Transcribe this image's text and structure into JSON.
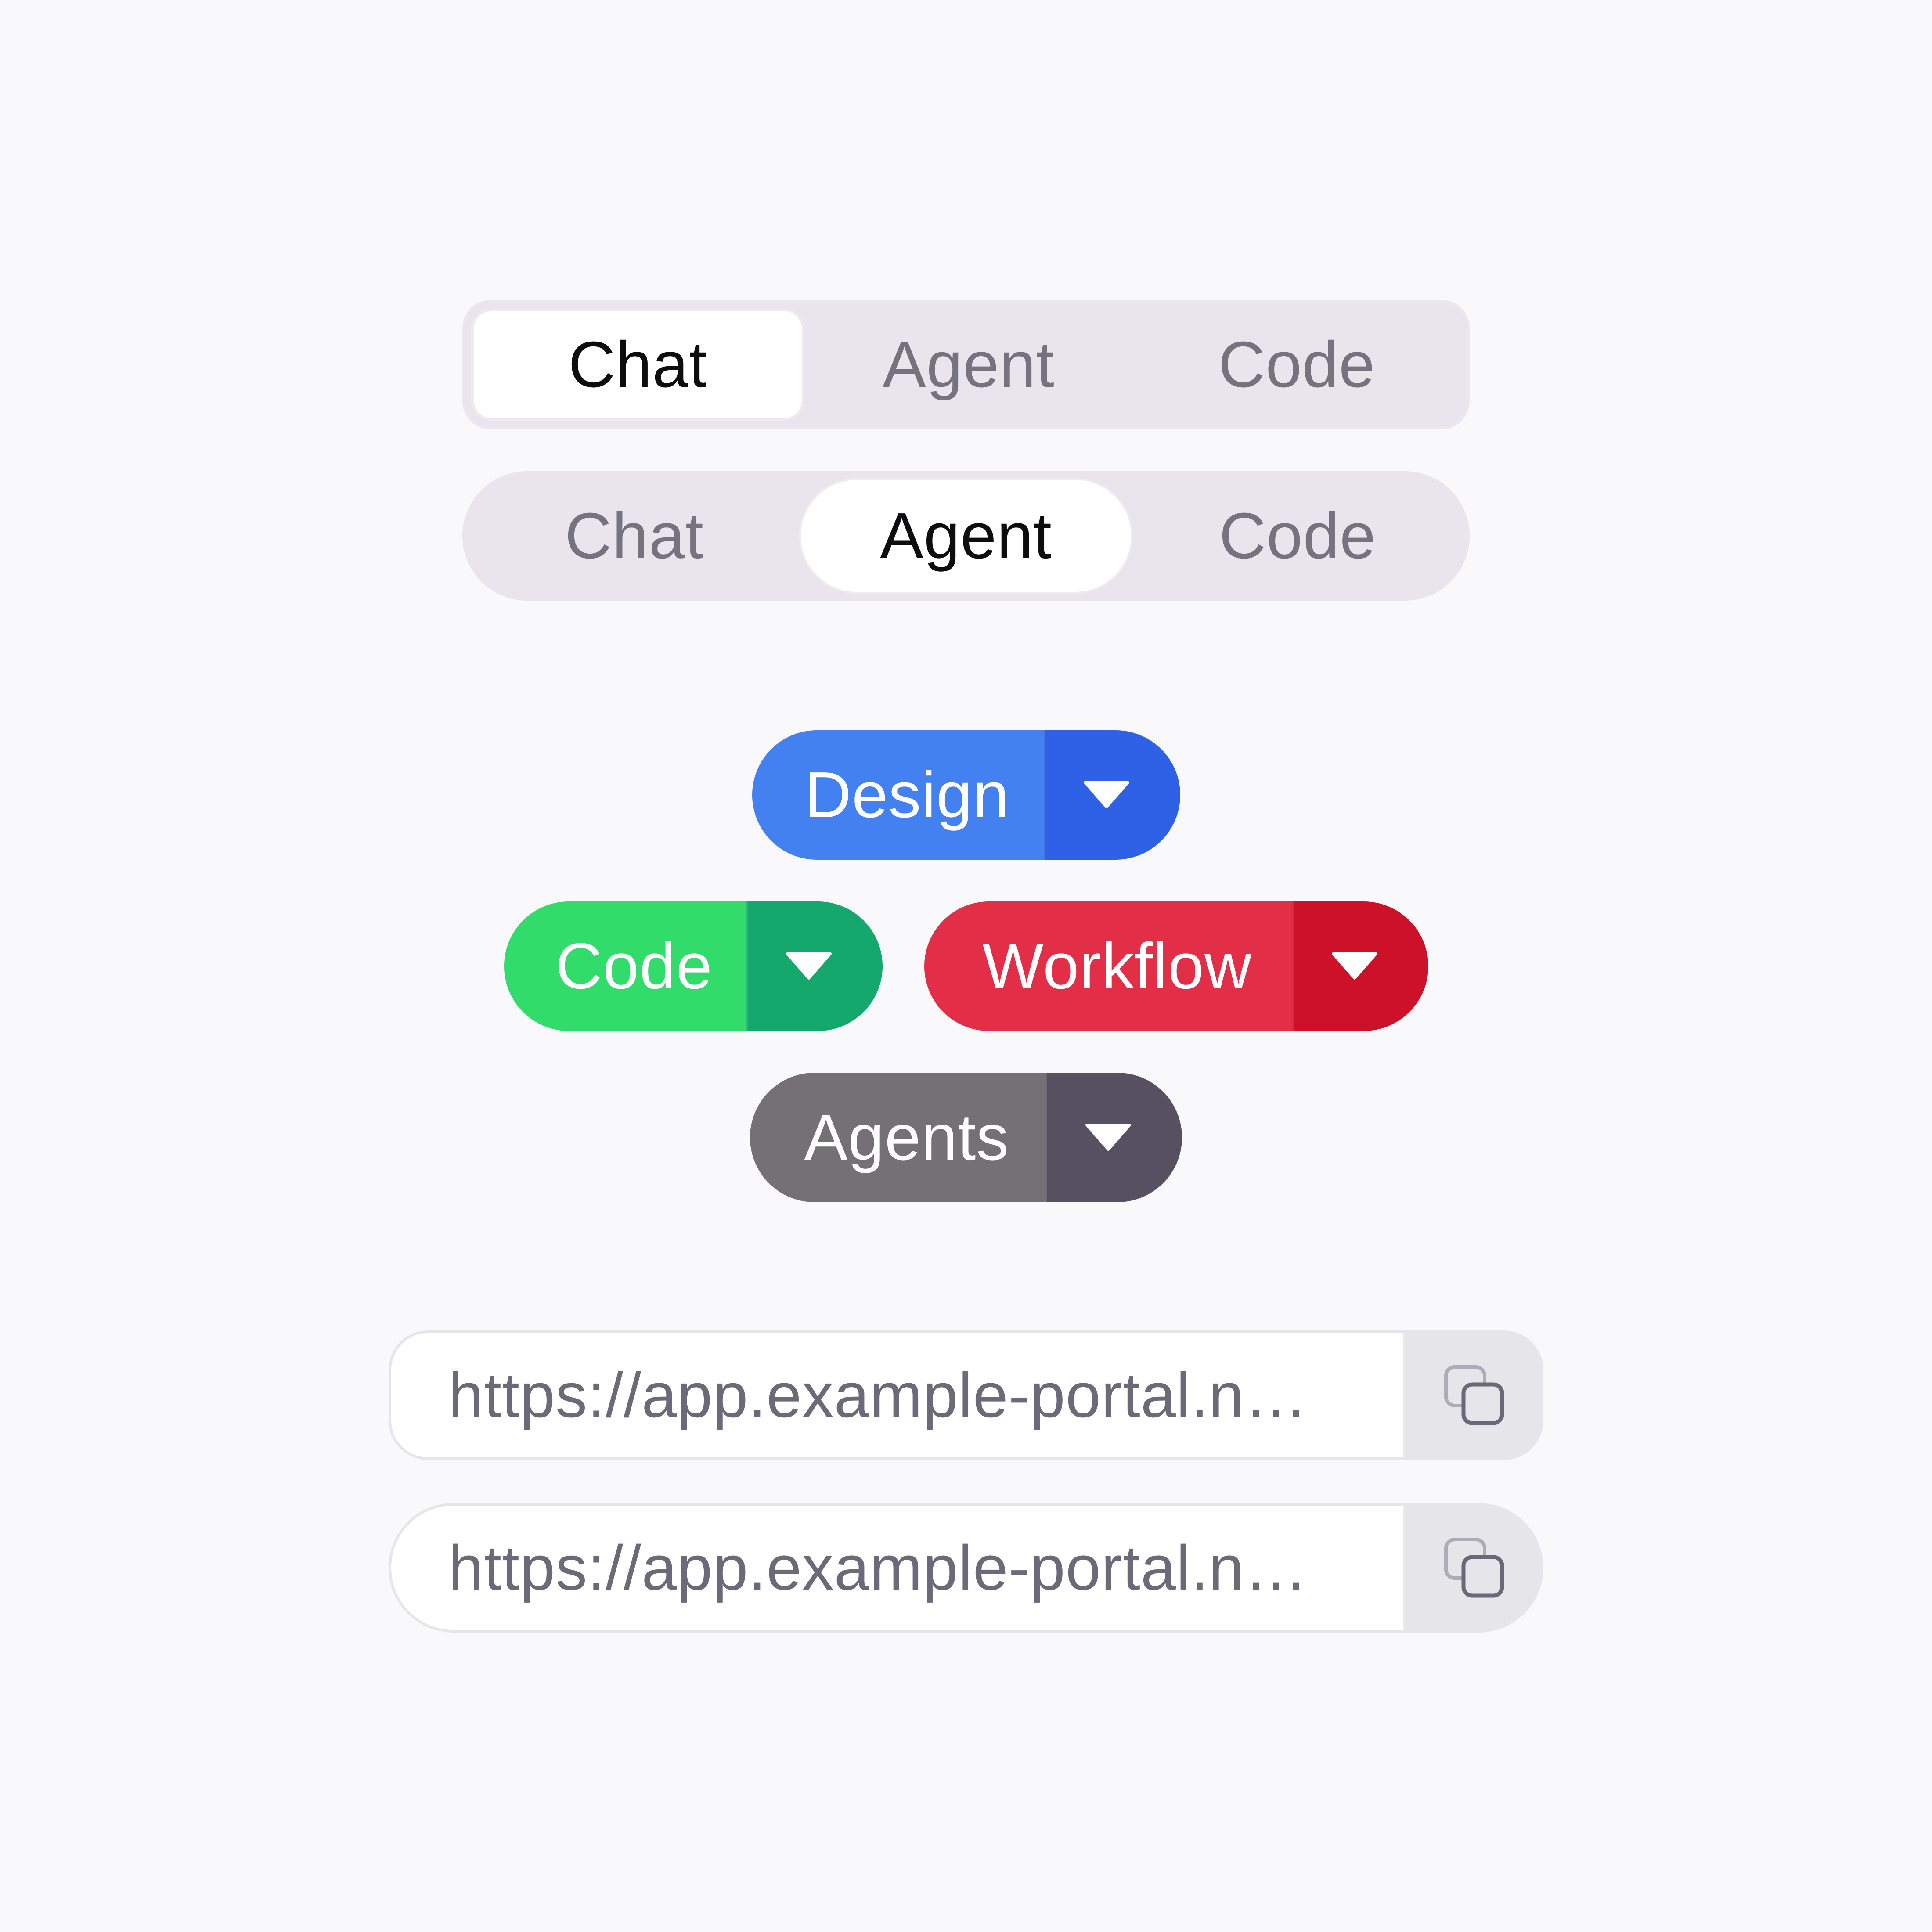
{
  "segmented_controls": [
    {
      "variant": "square",
      "items": [
        {
          "label": "Chat",
          "active": true
        },
        {
          "label": "Agent",
          "active": false
        },
        {
          "label": "Code",
          "active": false
        }
      ]
    },
    {
      "variant": "pill",
      "items": [
        {
          "label": "Chat",
          "active": false
        },
        {
          "label": "Agent",
          "active": true
        },
        {
          "label": "Code",
          "active": false
        }
      ]
    }
  ],
  "split_buttons": {
    "design": {
      "label": "Design",
      "main_color": "#4381f0",
      "caret_color": "#2e61e5",
      "icon": "caret-down-icon"
    },
    "code": {
      "label": "Code",
      "main_color": "#31dc6a",
      "caret_color": "#14a86d",
      "icon": "caret-down-icon"
    },
    "workflow": {
      "label": "Workflow",
      "main_color": "#e32e48",
      "caret_color": "#cd1129",
      "icon": "caret-down-icon"
    },
    "agents": {
      "label": "Agents",
      "main_color": "#737174",
      "caret_color": "#555160",
      "icon": "caret-down-icon"
    }
  },
  "url_fields": [
    {
      "variant": "rounded",
      "value": "https://app.example-portal.n…",
      "icon": "copy-icon"
    },
    {
      "variant": "pill",
      "value": "https://app.example-portal.n…",
      "icon": "copy-icon"
    }
  ],
  "colors": {
    "background": "#f9f8fb",
    "segment_track": "#e8e6ec",
    "segment_active_bg": "#ffffff",
    "segment_active_text": "#0d0d0f",
    "segment_inactive_text": "#75737d",
    "url_text": "#6c6a78",
    "copy_button_bg": "#e6e5ea"
  }
}
